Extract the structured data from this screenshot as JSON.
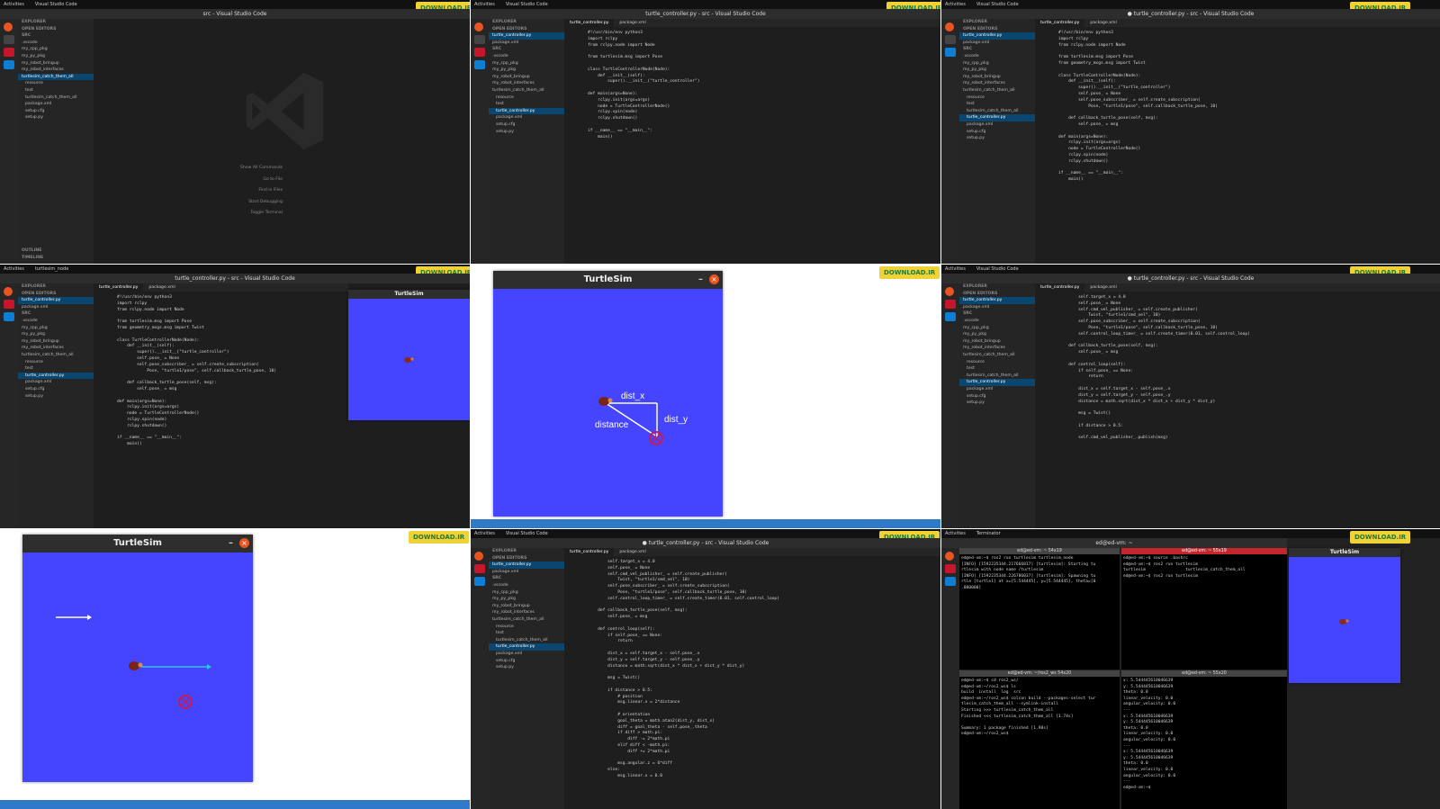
{
  "topbar": {
    "activities": "Activities",
    "app_menu": "Visual Studio Code",
    "terminator": "Terminator",
    "turtlesim_node": "turtlesim_node"
  },
  "watermark": "DOWNLOAD.IR",
  "vscode": {
    "title_src": "src - Visual Studio Code",
    "title_file": "turtle_controller.py - src - Visual Studio Code",
    "title_file_modified": "● turtle_controller.py - src - Visual Studio Code",
    "explorer": "EXPLORER",
    "open_editors": "OPEN EDITORS",
    "src": "SRC",
    "tree": [
      ".vscode",
      "my_cpp_pkg",
      "my_py_pkg",
      "my_robot_bringup",
      "my_robot_interfaces",
      "turtlesim_catch_them_all",
      "resource",
      "test",
      "turtlesim_catch_them_all",
      "package.xml",
      "setup.cfg",
      "setup.py"
    ],
    "tabs": [
      "turtle_controller.py",
      "package.xml"
    ],
    "outline": "OUTLINE",
    "timeline": "TIMELINE",
    "shortcuts": [
      "Show All Commands",
      "Go to File",
      "Find in Files",
      "Start Debugging",
      "Toggle Terminal"
    ],
    "code_a": [
      "#!/usr/bin/env python3",
      "import rclpy",
      "from rclpy.node import Node",
      "",
      "from turtlesim.msg import Pose",
      "",
      "class TurtleControllerNode(Node):",
      "    def __init__(self):",
      "        super().__init__(\"turtle_controller\")",
      "",
      "def main(args=None):",
      "    rclpy.init(args=args)",
      "    node = TurtleControllerNode()",
      "    rclpy.spin(node)",
      "    rclpy.shutdown()",
      "",
      "if __name__ == \"__main__\":",
      "    main()"
    ],
    "code_b": [
      "#!/usr/bin/env python3",
      "import rclpy",
      "from rclpy.node import Node",
      "",
      "from turtlesim.msg import Pose",
      "from geometry_msgs.msg import Twist",
      "",
      "class TurtleControllerNode(Node):",
      "    def __init__(self):",
      "        super().__init__(\"turtle_controller\")",
      "        self.pose_ = None",
      "        self.pose_subscriber_ = self.create_subscription(",
      "            Pose, \"turtle1/pose\", self.callback_turtle_pose, 10)",
      "",
      "    def callback_turtle_pose(self, msg):",
      "        self.pose_ = msg",
      "",
      "def main(args=None):",
      "    rclpy.init(args=args)",
      "    node = TurtleControllerNode()",
      "    rclpy.spin(node)",
      "    rclpy.shutdown()",
      "",
      "if __name__ == \"__main__\":",
      "    main()"
    ],
    "code_c": [
      "        self.target_x = 4.0",
      "        self.pose_ = None",
      "        self.cmd_vel_publisher_ = self.create_publisher(",
      "            Twist, \"turtle1/cmd_vel\", 10)",
      "        self.pose_subscriber_ = self.create_subscription(",
      "            Pose, \"turtle1/pose\", self.callback_turtle_pose, 10)",
      "        self.control_loop_timer_ = self.create_timer(0.01, self.control_loop)",
      "",
      "    def callback_turtle_pose(self, msg):",
      "        self.pose_ = msg",
      "",
      "    def control_loop(self):",
      "        if self.pose_ == None:",
      "            return",
      "",
      "        dist_x = self.target_x - self.pose_.x",
      "        dist_y = self.target_y - self.pose_.y",
      "        distance = math.sqrt(dist_x * dist_x + dist_y * dist_y)",
      "",
      "        msg = Twist()",
      "",
      "        if distance > 0.5:",
      "",
      "        self.cmd_vel_publisher_.publish(msg)"
    ],
    "code_d": [
      "        self.target_x = 4.0",
      "        self.pose_ = None",
      "        self.cmd_vel_publisher_ = self.create_publisher(",
      "            Twist, \"turtle1/cmd_vel\", 10)",
      "        self.pose_subscriber_ = self.create_subscription(",
      "            Pose, \"turtle1/pose\", self.callback_turtle_pose, 10)",
      "        self.control_loop_timer_ = self.create_timer(0.01, self.control_loop)",
      "",
      "    def callback_turtle_pose(self, msg):",
      "        self.pose_ = msg",
      "",
      "    def control_loop(self):",
      "        if self.pose_ == None:",
      "            return",
      "",
      "        dist_x = self.target_x - self.pose_.x",
      "        dist_y = self.target_y - self.pose_.y",
      "        distance = math.sqrt(dist_x * dist_x + dist_y * dist_y)",
      "",
      "        msg = Twist()",
      "",
      "        if distance > 0.5:",
      "            # position",
      "            msg.linear.x = 2*distance",
      "",
      "            # orientation",
      "            goal_theta = math.atan2(dist_y, dist_x)",
      "            diff = goal_theta - self.pose_.theta",
      "            if diff > math.pi:",
      "                diff -= 2*math.pi",
      "            elif diff < -math.pi:",
      "                diff += 2*math.pi",
      "",
      "            msg.angular.z = 6*diff",
      "        else:",
      "            msg.linear.x = 0.0"
    ]
  },
  "turtlesim": {
    "title": "TurtleSim",
    "labels": {
      "dist_x": "dist_x",
      "dist_y": "dist_y",
      "distance": "distance"
    },
    "bg_color": "#4545ff"
  },
  "terminals": {
    "title_user": "ed@ed-vm: ~",
    "t1_title": "ed@ed-vm: ~ 54x19",
    "t2_title": "ed@ed-vm: ~ 55x19",
    "t3_title": "ed@ed-vm: ~/ros2_ws 54x20",
    "t4_title": "ed@ed-vm: ~ 55x20",
    "t1": [
      "ed@ed-vm:~$ ros2 run turtlesim turtlesim_node",
      "[INFO] [1592235344.217666817] [turtlesim]: Starting tu",
      "rtlesim with node name /turtlesim",
      "[INFO] [1592235344.226786037] [turtlesim]: Spawning tu",
      "rtle [turtle1] at x=[5.544445], y=[5.544445], theta=[0",
      ".000000]"
    ],
    "t2": [
      "ed@ed-vm:~$ source .bashrc",
      "ed@ed-vm:~$ ros2 run turtlesim",
      "turtlesim                turtlesim_catch_them_all",
      "ed@ed-vm:~$ ros2 run turtlesim"
    ],
    "t3": [
      "ed@ed-vm:~$ cd ros2_ws/",
      "ed@ed-vm:~/ros2_ws$ ls",
      "build  install  log  src",
      "ed@ed-vm:~/ros2_ws$ colcon build --packages-select tur",
      "tlesim_catch_them_all --symlink-install",
      "Starting >>> turtlesim_catch_them_all",
      "Finished <<< turtlesim_catch_them_all [1.74s]",
      "",
      "Summary: 1 package finished [1.98s]",
      "ed@ed-vm:~/ros2_ws$"
    ],
    "t4": [
      "x: 5.544445610046639",
      "y: 5.544445610046639",
      "theta: 0.0",
      "linear_velocity: 0.0",
      "angular_velocity: 0.0",
      "---",
      "x: 5.544445610046639",
      "y: 5.544445610046639",
      "theta: 0.0",
      "linear_velocity: 0.0",
      "angular_velocity: 0.0",
      "---",
      "x: 5.544445610046639",
      "y: 5.544445610046639",
      "theta: 0.0",
      "linear_velocity: 0.0",
      "angular_velocity: 0.0",
      "---",
      "ed@ed-vm:~$"
    ]
  }
}
